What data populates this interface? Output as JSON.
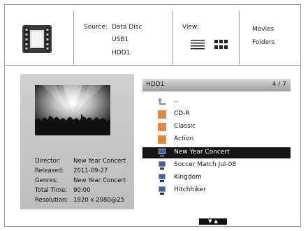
{
  "header": {
    "source_label": "Source:",
    "sources": [
      "Data Disc",
      "USB1",
      "HDD1"
    ],
    "view_label": "View:",
    "modes": [
      "Movies",
      "Folders"
    ]
  },
  "info": {
    "fields": [
      {
        "key": "Director:",
        "value": "New Year Concert"
      },
      {
        "key": "Released:",
        "value": "2011-09-27"
      },
      {
        "key": "Genres:",
        "value": "New Year Concert"
      },
      {
        "key": "Total Time:",
        "value": "90:00"
      },
      {
        "key": "Resolution:",
        "value": "1920 x 2080@25"
      }
    ]
  },
  "list": {
    "title": "HDD1",
    "position": "4 / 7",
    "items": [
      {
        "label": "..",
        "icon": "up-arrow-icon"
      },
      {
        "label": "CD-R",
        "icon": "folder-icon"
      },
      {
        "label": "Classic",
        "icon": "folder-icon"
      },
      {
        "label": "Action",
        "icon": "folder-icon"
      },
      {
        "label": "New Year Concert",
        "icon": "video-file-icon",
        "selected": true
      },
      {
        "label": "Soccer Match Jul-08",
        "icon": "video-file-icon"
      },
      {
        "label": "Kingdom",
        "icon": "video-file-icon"
      },
      {
        "label": "Hitchhiker",
        "icon": "video-file-icon"
      }
    ]
  },
  "colors": {
    "selection": "#141414",
    "folder": "#e08b3c",
    "panel": "#c6c6c6"
  }
}
